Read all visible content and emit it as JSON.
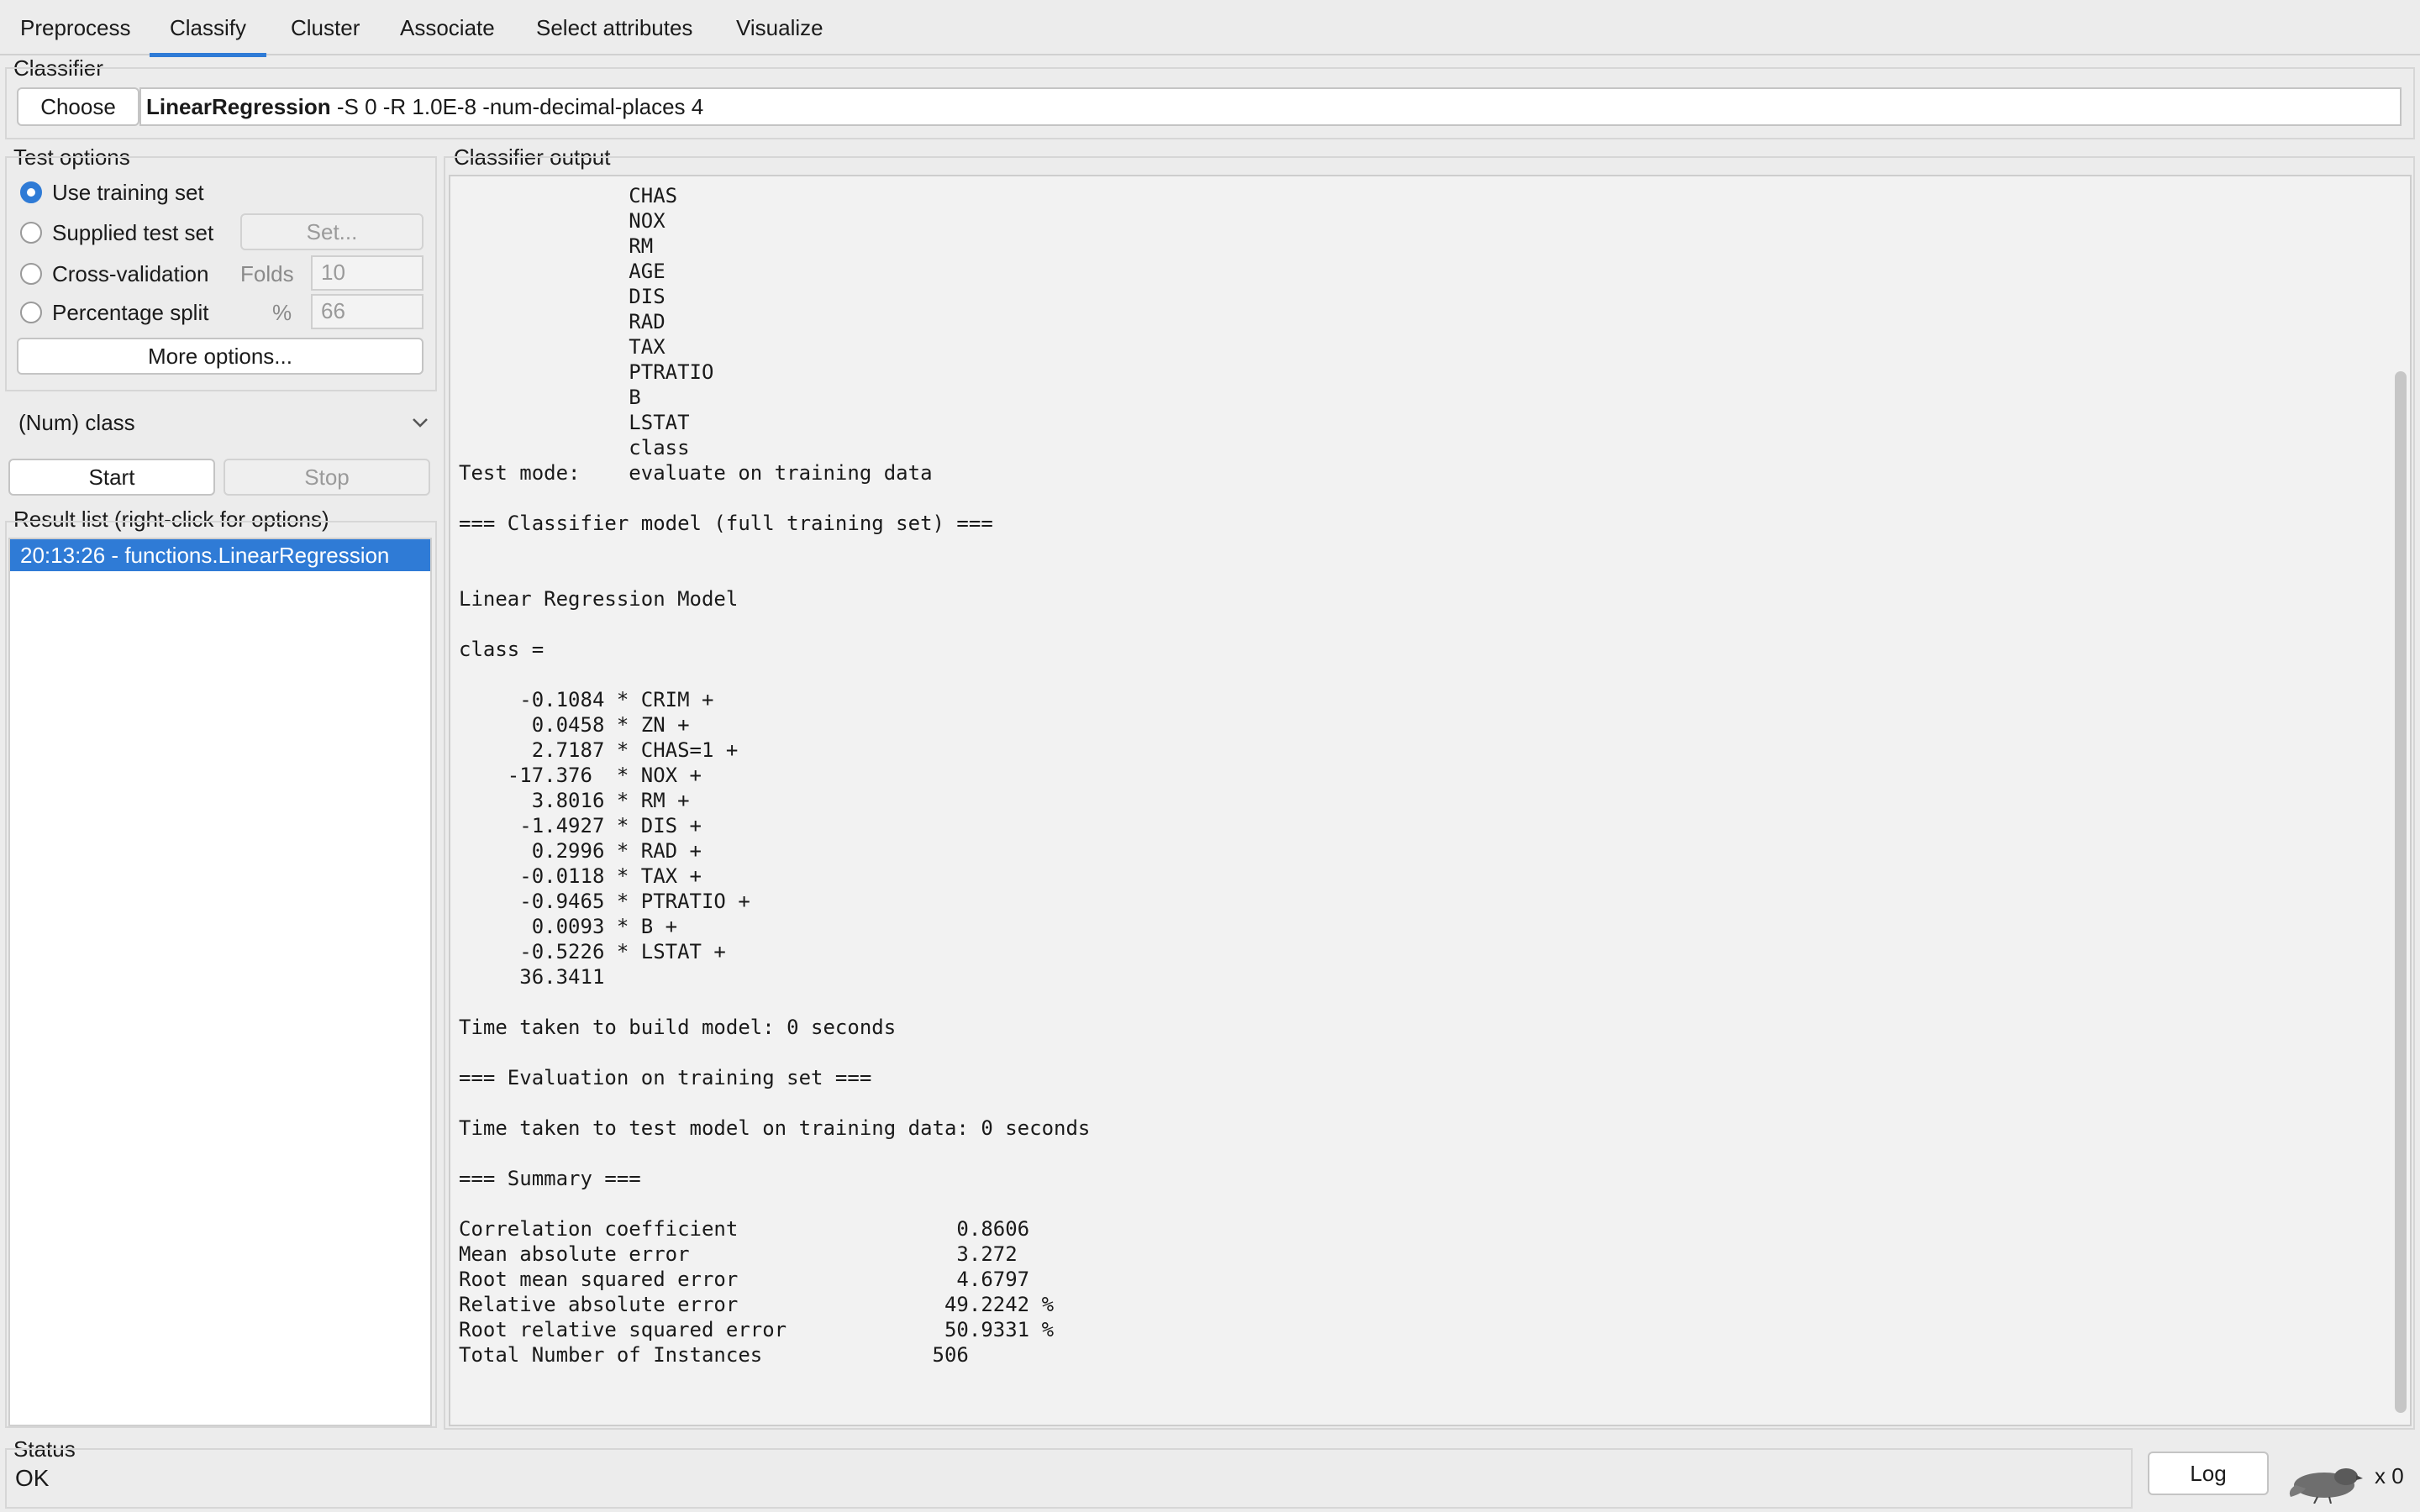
{
  "tabs": [
    "Preprocess",
    "Classify",
    "Cluster",
    "Associate",
    "Select attributes",
    "Visualize"
  ],
  "active_tab": "Classify",
  "classifier": {
    "section_label": "Classifier",
    "choose_label": "Choose",
    "name": "LinearRegression",
    "options": " -S 0 -R 1.0E-8 -num-decimal-places 4"
  },
  "test_options": {
    "section_label": "Test options",
    "use_training_set": "Use training set",
    "supplied_test_set": "Supplied test set",
    "set_button": "Set...",
    "cross_validation": "Cross-validation",
    "folds_label": "Folds",
    "folds_value": "10",
    "percentage_split": "Percentage split",
    "percent_label": "%",
    "percent_value": "66",
    "more_options": "More options...",
    "selected": "Use training set"
  },
  "class_select": {
    "value": "(Num) class"
  },
  "controls": {
    "start": "Start",
    "stop": "Stop"
  },
  "result_list": {
    "label": "Result list (right-click for options)",
    "items": [
      "20:13:26 - functions.LinearRegression"
    ]
  },
  "output": {
    "label": "Classifier output",
    "lines": [
      "              CHAS",
      "              NOX",
      "              RM",
      "              AGE",
      "              DIS",
      "              RAD",
      "              TAX",
      "              PTRATIO",
      "              B",
      "              LSTAT",
      "              class",
      "Test mode:    evaluate on training data",
      "",
      "=== Classifier model (full training set) ===",
      "",
      "",
      "Linear Regression Model",
      "",
      "class =",
      "",
      "     -0.1084 * CRIM +",
      "      0.0458 * ZN +",
      "      2.7187 * CHAS=1 +",
      "    -17.376  * NOX +",
      "      3.8016 * RM +",
      "     -1.4927 * DIS +",
      "      0.2996 * RAD +",
      "     -0.0118 * TAX +",
      "     -0.9465 * PTRATIO +",
      "      0.0093 * B +",
      "     -0.5226 * LSTAT +",
      "     36.3411",
      "",
      "Time taken to build model: 0 seconds",
      "",
      "=== Evaluation on training set ===",
      "",
      "Time taken to test model on training data: 0 seconds",
      "",
      "=== Summary ===",
      "",
      "Correlation coefficient                  0.8606",
      "Mean absolute error                      3.272 ",
      "Root mean squared error                  4.6797",
      "Relative absolute error                 49.2242 %",
      "Root relative squared error             50.9331 %",
      "Total Number of Instances              506     "
    ]
  },
  "status": {
    "label": "Status",
    "text": "OK",
    "log_button": "Log",
    "count": "x 0"
  }
}
